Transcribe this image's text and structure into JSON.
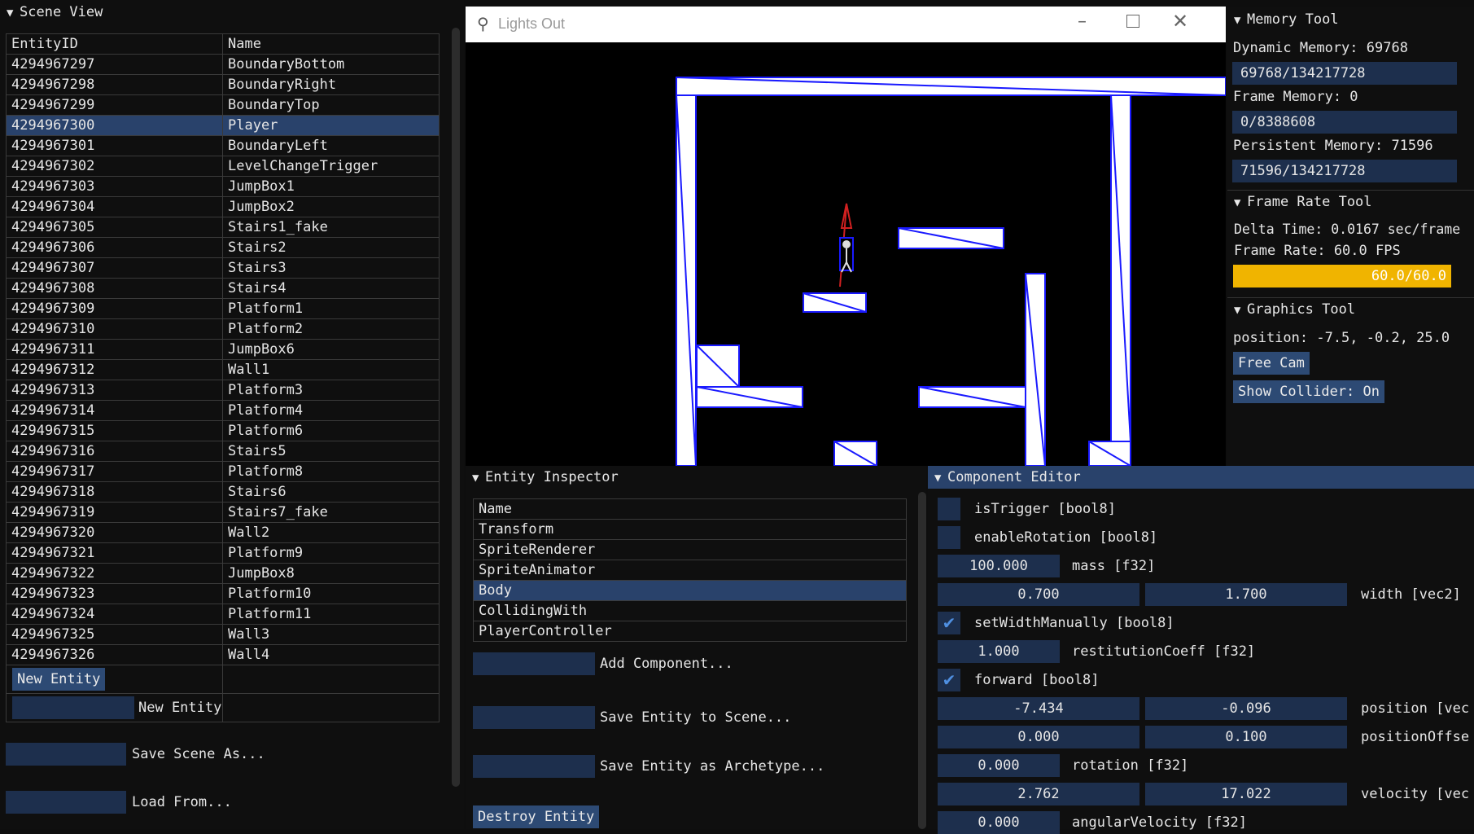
{
  "scene_view": {
    "title": "Scene View",
    "columns": [
      "EntityID",
      "Name"
    ],
    "rows": [
      [
        "4294967297",
        "BoundaryBottom"
      ],
      [
        "4294967298",
        "BoundaryRight"
      ],
      [
        "4294967299",
        "BoundaryTop"
      ],
      [
        "4294967300",
        "Player"
      ],
      [
        "4294967301",
        "BoundaryLeft"
      ],
      [
        "4294967302",
        "LevelChangeTrigger"
      ],
      [
        "4294967303",
        "JumpBox1"
      ],
      [
        "4294967304",
        "JumpBox2"
      ],
      [
        "4294967305",
        "Stairs1_fake"
      ],
      [
        "4294967306",
        "Stairs2"
      ],
      [
        "4294967307",
        "Stairs3"
      ],
      [
        "4294967308",
        "Stairs4"
      ],
      [
        "4294967309",
        "Platform1"
      ],
      [
        "4294967310",
        "Platform2"
      ],
      [
        "4294967311",
        "JumpBox6"
      ],
      [
        "4294967312",
        "Wall1"
      ],
      [
        "4294967313",
        "Platform3"
      ],
      [
        "4294967314",
        "Platform4"
      ],
      [
        "4294967315",
        "Platform6"
      ],
      [
        "4294967316",
        "Stairs5"
      ],
      [
        "4294967317",
        "Platform8"
      ],
      [
        "4294967318",
        "Stairs6"
      ],
      [
        "4294967319",
        "Stairs7_fake"
      ],
      [
        "4294967320",
        "Wall2"
      ],
      [
        "4294967321",
        "Platform9"
      ],
      [
        "4294967322",
        "JumpBox8"
      ],
      [
        "4294967323",
        "Platform10"
      ],
      [
        "4294967324",
        "Platform11"
      ],
      [
        "4294967325",
        "Wall3"
      ],
      [
        "4294967326",
        "Wall4"
      ]
    ],
    "selected_row": 3,
    "new_entity_button": "New Entity",
    "new_entity_label": "New Entity",
    "save_scene_label": "Save Scene As...",
    "load_from_label": "Load From..."
  },
  "game_window": {
    "title": "Lights Out"
  },
  "memory_tool": {
    "title": "Memory Tool",
    "dynamic_label": "Dynamic Memory: 69768",
    "dynamic_value": "69768/134217728",
    "frame_label": "Frame Memory: 0",
    "frame_value": "0/8388608",
    "persistent_label": "Persistent Memory: 71596",
    "persistent_value": "71596/134217728"
  },
  "frame_rate_tool": {
    "title": "Frame Rate Tool",
    "delta_time": "Delta Time: 0.0167 sec/frame",
    "frame_rate": "Frame Rate: 60.0 FPS",
    "bar_text": "60.0/60.0",
    "bar_fraction": 1.0
  },
  "graphics_tool": {
    "title": "Graphics Tool",
    "position": "position: -7.5, -0.2, 25.0",
    "free_cam": "Free Cam",
    "show_collider": "Show Collider: On"
  },
  "entity_inspector": {
    "title": "Entity Inspector",
    "header": "Name",
    "components": [
      "Transform",
      "SpriteRenderer",
      "SpriteAnimator",
      "Body",
      "CollidingWith",
      "PlayerController"
    ],
    "selected_component": 3,
    "add_component": "Add Component...",
    "save_to_scene": "Save Entity to Scene...",
    "save_archetype": "Save Entity as Archetype...",
    "destroy": "Destroy Entity"
  },
  "component_editor": {
    "title": "Component Editor",
    "is_trigger": "isTrigger [bool8]",
    "enable_rotation": "enableRotation [bool8]",
    "mass_value": "100.000",
    "mass_label": "mass [f32]",
    "width_x": "0.700",
    "width_y": "1.700",
    "width_label": "width [vec2]",
    "set_width_manually": "setWidthManually [bool8]",
    "restitution_value": "1.000",
    "restitution_label": "restitutionCoeff [f32]",
    "forward": "forward [bool8]",
    "position_x": "-7.434",
    "position_y": "-0.096",
    "position_label": "position [vec",
    "offset_x": "0.000",
    "offset_y": "0.100",
    "offset_label": "positionOffse",
    "rotation_value": "0.000",
    "rotation_label": "rotation [f32]",
    "velocity_x": "2.762",
    "velocity_y": "17.022",
    "velocity_label": "velocity [vec",
    "angular_value": "0.000",
    "angular_label": "angularVelocity [f32]",
    "checks": {
      "is_trigger": false,
      "enable_rotation": false,
      "set_width_manually": true,
      "forward": true
    }
  },
  "colors": {
    "selection": "#29426b",
    "field": "#1d2f4d",
    "button": "#2d4a74",
    "fps_bar": "#f0b400",
    "collider": "#1a1aff"
  }
}
